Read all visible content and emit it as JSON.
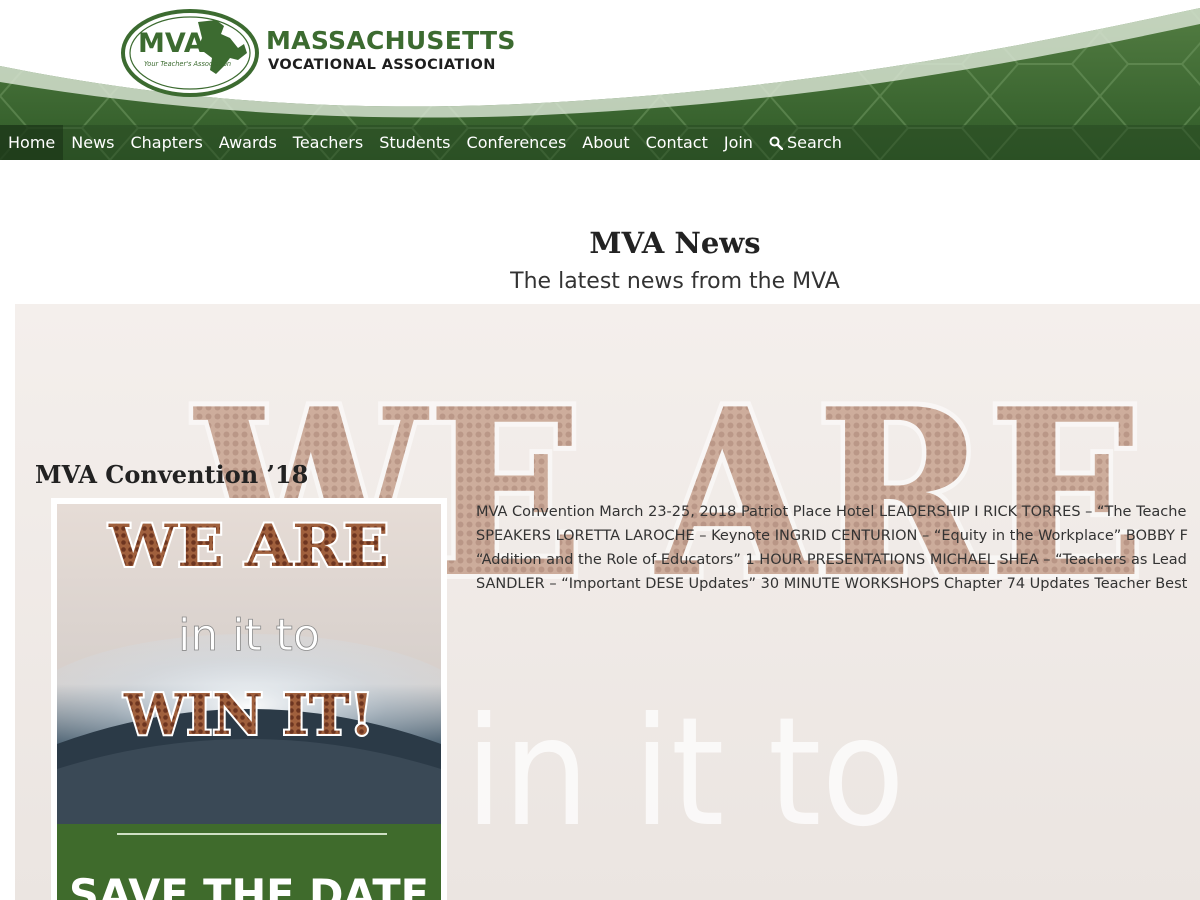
{
  "brand": {
    "logo_letters": "MVA",
    "logo_tagline": "Your Teacher's Association",
    "name_line1": "MASSACHUSETTS",
    "name_line2": "VOCATIONAL ASSOCIATION"
  },
  "nav": {
    "items": [
      {
        "label": "Home",
        "active": true
      },
      {
        "label": "News"
      },
      {
        "label": "Chapters"
      },
      {
        "label": "Awards"
      },
      {
        "label": "Teachers"
      },
      {
        "label": "Students"
      },
      {
        "label": "Conferences"
      },
      {
        "label": "About"
      },
      {
        "label": "Contact"
      },
      {
        "label": "Join"
      },
      {
        "label": "Search",
        "icon": "search-icon"
      }
    ]
  },
  "page": {
    "title": "MVA News",
    "subtitle": "The latest news from the MVA"
  },
  "post": {
    "background_art": {
      "headline": "WE ARE",
      "subline": "in it to"
    },
    "title": "MVA Convention ’18",
    "thumbnail": {
      "line1": "WE ARE",
      "line2": "in it to",
      "line3": "WIN IT!",
      "line4": "SAVE THE DATE"
    },
    "excerpt_lines": [
      "MVA Convention March 23-25, 2018 Patriot Place Hotel   LEADERSHIP I RICK TORRES – “The Teache",
      "SPEAKERS LORETTA LAROCHE – Keynote INGRID CENTURION – “Equity in the Workplace” BOBBY F",
      "“Addition and the Role of Educators” 1 HOUR PRESENTATIONS MICHAEL SHEA – “Teachers as Lead",
      "SANDLER – “Important DESE Updates” 30 MINUTE WORKSHOPS Chapter 74 Updates Teacher Best"
    ]
  },
  "colors": {
    "brand_green": "#3c6b30",
    "nav_overlay": "#2d5227",
    "football_brown": "#8a4a2a"
  }
}
